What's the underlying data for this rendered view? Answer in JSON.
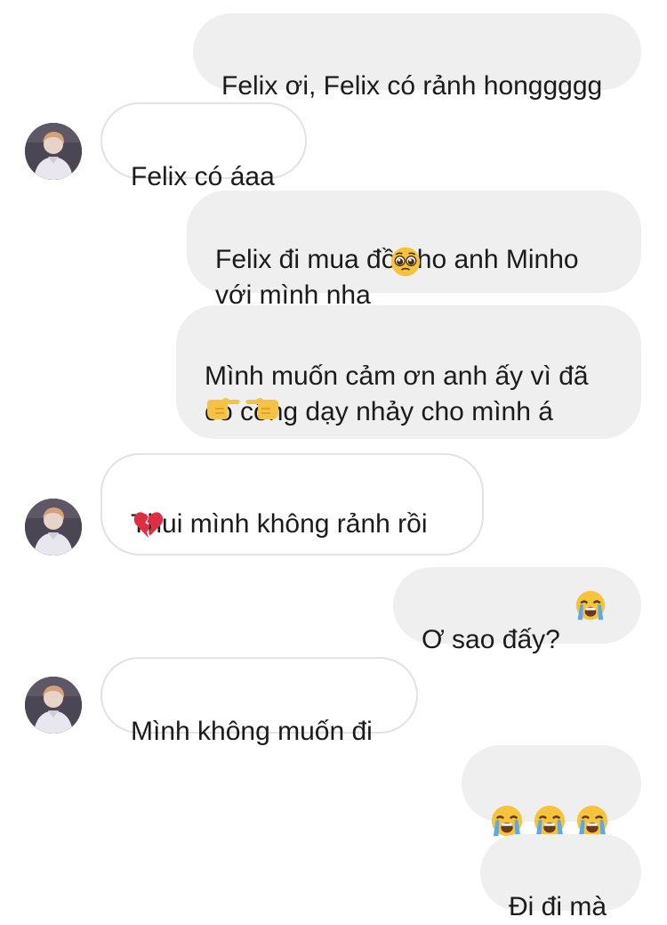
{
  "messages": [
    {
      "sender": "me",
      "text": "Felix ơi, Felix có rảnh honggggg"
    },
    {
      "sender": "other",
      "text": "Felix có áaa"
    },
    {
      "sender": "me",
      "text": "Felix đi mua đồ cho anh Minho\nvới mình nha",
      "emoji": "pleading-face"
    },
    {
      "sender": "me",
      "text": "Mình muốn cảm ơn anh ấy vì đã\ncó công dạy nhảy cho mình á",
      "emoji": "pointing-fingers"
    },
    {
      "sender": "other",
      "text": "Thui mình không rảnh rồi",
      "emoji": "broken-heart"
    },
    {
      "sender": "me",
      "text": "Ơ sao đấy?",
      "emoji": "loudly-crying-face"
    },
    {
      "sender": "other",
      "text": "Mình không muốn đi"
    },
    {
      "sender": "me",
      "text": "",
      "emoji": "loudly-crying-face x3"
    },
    {
      "sender": "me",
      "text": "Đi đi mà"
    }
  ],
  "colors": {
    "sent_bubble": "#efefef",
    "received_bubble": "#ffffff",
    "received_border": "#e2e2e2",
    "text": "#1b1b1b"
  }
}
